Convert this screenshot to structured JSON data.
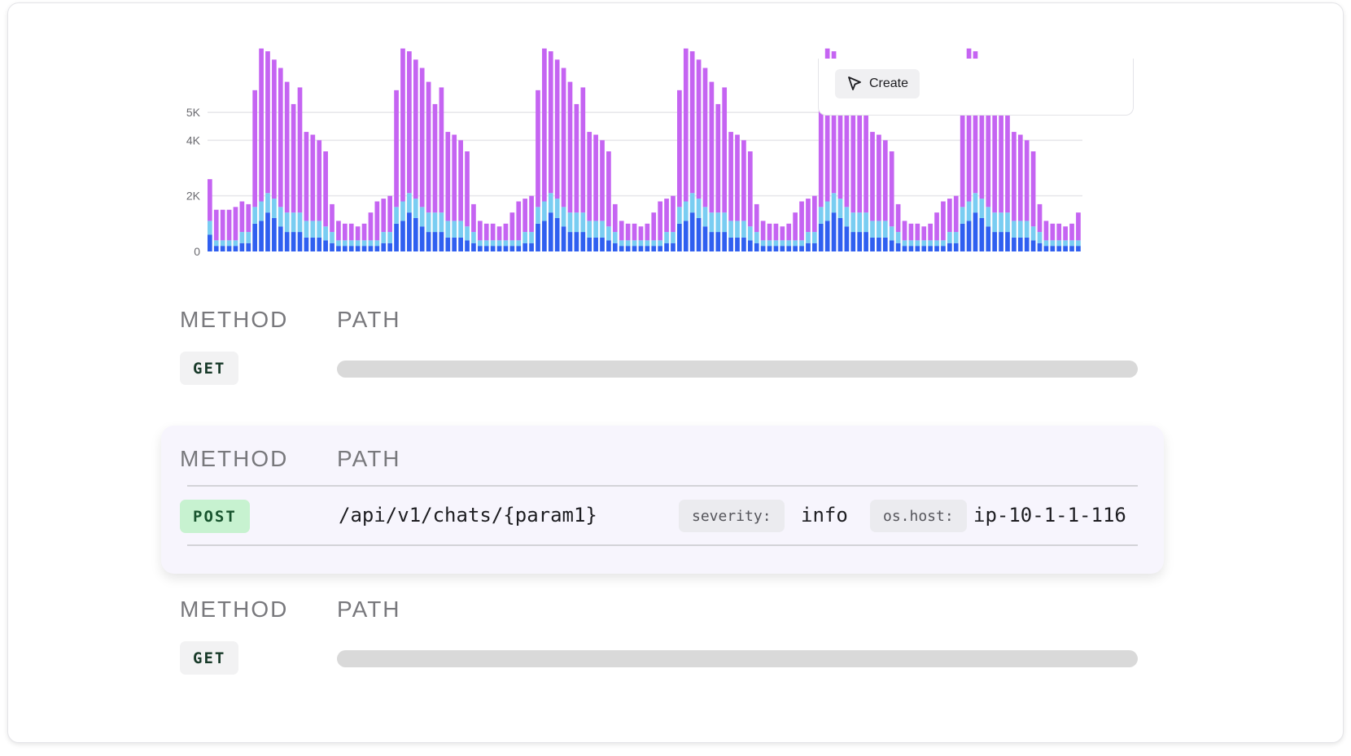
{
  "create_button": {
    "label": "Create",
    "icon": "cursor-arrow-icon"
  },
  "rows": [
    {
      "method_header": "METHOD",
      "path_header": "PATH",
      "method": "GET"
    },
    {
      "method_header": "METHOD",
      "path_header": "PATH",
      "method": "POST",
      "path": "/api/v1/chats/{param1}",
      "tags": [
        {
          "key": "severity:",
          "value": "info"
        },
        {
          "key": "os.host:",
          "value": "ip-10-1-1-116"
        }
      ]
    },
    {
      "method_header": "METHOD",
      "path_header": "PATH",
      "method": "GET"
    }
  ],
  "colors": {
    "series_bottom": "#2f5ff0",
    "series_middle": "#79cdf2",
    "series_top": "#c564f2",
    "post_badge_bg": "#c7f2d0",
    "get_badge_bg": "#f2f2f3",
    "selected_card_bg": "#f7f5fd"
  },
  "chart_data": {
    "type": "bar",
    "stacked": true,
    "ylim": [
      0,
      6000
    ],
    "yticks": [
      {
        "value": 0,
        "label": "0"
      },
      {
        "value": 2000,
        "label": "2K"
      },
      {
        "value": 4000,
        "label": "4K"
      },
      {
        "value": 5000,
        "label": "5K"
      }
    ],
    "grid": true,
    "legend": "none",
    "series": [
      {
        "color": "#2f5ff0",
        "values": [
          600,
          200,
          200,
          200,
          200,
          300,
          300,
          1000,
          1100,
          1400,
          1200,
          900,
          700,
          700,
          700,
          500,
          500,
          500,
          400,
          300,
          200,
          200,
          200,
          200,
          200,
          200,
          200,
          300,
          300,
          1000,
          1100,
          1400,
          1200,
          900,
          700,
          700,
          700,
          500,
          500,
          500,
          400,
          300,
          200,
          200,
          200,
          200,
          200,
          200,
          200,
          300,
          300,
          1000,
          1100,
          1400,
          1200,
          900,
          700,
          700,
          700,
          500,
          500,
          500,
          400,
          300,
          200,
          200,
          200,
          200,
          200,
          200,
          200,
          300,
          300,
          1000,
          1100,
          1400,
          1200,
          900,
          700,
          700,
          700,
          500,
          500,
          500,
          400,
          300,
          200,
          200,
          200,
          200,
          200,
          200,
          200,
          300,
          300,
          1000,
          1100,
          1400,
          1200,
          900,
          700,
          700,
          700,
          500,
          500,
          500,
          400,
          300,
          200,
          200,
          200,
          200,
          200,
          200,
          200,
          300,
          300,
          1000,
          1100,
          1400,
          1200,
          900,
          700,
          700,
          700,
          500,
          500,
          500,
          400,
          300,
          200,
          200,
          200,
          200,
          200,
          200
        ]
      },
      {
        "color": "#79cdf2",
        "values": [
          500,
          200,
          200,
          200,
          200,
          400,
          400,
          600,
          700,
          700,
          700,
          700,
          700,
          700,
          700,
          600,
          600,
          600,
          500,
          400,
          200,
          200,
          200,
          200,
          200,
          200,
          200,
          400,
          400,
          600,
          700,
          700,
          700,
          700,
          700,
          700,
          700,
          600,
          600,
          600,
          500,
          400,
          200,
          200,
          200,
          200,
          200,
          200,
          200,
          400,
          400,
          600,
          700,
          700,
          700,
          700,
          700,
          700,
          700,
          600,
          600,
          600,
          500,
          400,
          200,
          200,
          200,
          200,
          200,
          200,
          200,
          400,
          400,
          600,
          700,
          700,
          700,
          700,
          700,
          700,
          700,
          600,
          600,
          600,
          500,
          400,
          200,
          200,
          200,
          200,
          200,
          200,
          200,
          400,
          400,
          600,
          700,
          700,
          700,
          700,
          700,
          700,
          700,
          600,
          600,
          600,
          500,
          400,
          200,
          200,
          200,
          200,
          200,
          200,
          200,
          400,
          400,
          600,
          700,
          700,
          700,
          700,
          700,
          700,
          700,
          600,
          600,
          600,
          500,
          400,
          200,
          200,
          200,
          200,
          200,
          200
        ]
      },
      {
        "color": "#c564f2",
        "values": [
          1500,
          1100,
          1100,
          1100,
          1200,
          1100,
          1000,
          4200,
          5500,
          5100,
          5000,
          5000,
          4700,
          3900,
          4500,
          3200,
          3100,
          2900,
          2700,
          1000,
          700,
          600,
          600,
          500,
          600,
          1000,
          1400,
          1200,
          1300,
          4200,
          5500,
          5100,
          5000,
          5000,
          4700,
          3900,
          4500,
          3200,
          3100,
          2900,
          2700,
          1000,
          700,
          600,
          600,
          500,
          600,
          1000,
          1400,
          1200,
          1300,
          4200,
          5500,
          5100,
          5000,
          5000,
          4700,
          3900,
          4500,
          3200,
          3100,
          2900,
          2700,
          1000,
          700,
          600,
          600,
          500,
          600,
          1000,
          1400,
          1200,
          1300,
          4200,
          5500,
          5100,
          5000,
          5000,
          4700,
          3900,
          4500,
          3200,
          3100,
          2900,
          2700,
          1000,
          700,
          600,
          600,
          500,
          600,
          1000,
          1400,
          1200,
          1300,
          4200,
          5500,
          5100,
          5000,
          5000,
          4700,
          3900,
          4500,
          3200,
          3100,
          2900,
          2700,
          1000,
          700,
          600,
          600,
          500,
          600,
          1000,
          1400,
          1200,
          1300,
          4200,
          5500,
          5100,
          5000,
          5000,
          4700,
          3900,
          4500,
          3200,
          3100,
          2900,
          2700,
          1000,
          700,
          600,
          600,
          500,
          600,
          1000
        ]
      }
    ]
  }
}
